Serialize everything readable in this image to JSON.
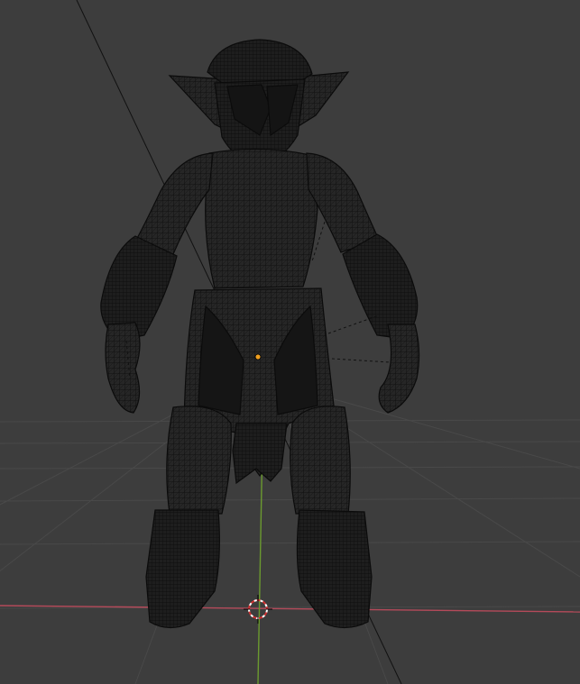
{
  "viewport": {
    "mode": "wireframe",
    "background_color": "#3d3d3d",
    "grid_color": "#4a4a4a",
    "x_axis_color": "#b54a5a",
    "y_axis_color": "#6b9a2f",
    "mesh_color": "#1c1c1c",
    "wire_color": "#0e0e0e",
    "origin_color": "#f0a020",
    "cursor_color": "#ffffff",
    "cursor_accent": "#d03030"
  }
}
